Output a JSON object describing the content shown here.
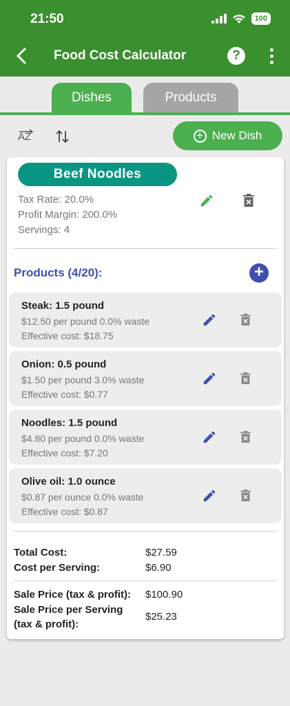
{
  "status": {
    "time": "21:50",
    "battery": "100"
  },
  "app": {
    "title": "Food Cost Calculator"
  },
  "tabs": [
    {
      "label": "Dishes"
    },
    {
      "label": "Products"
    }
  ],
  "toolbar": {
    "new_dish_label": "New Dish"
  },
  "dish": {
    "name": "Beef Noodles",
    "tax_rate": "Tax Rate: 20.0%",
    "profit_margin": "Profit Margin: 200.0%",
    "servings": "Servings: 4",
    "products_title": "Products (4/20):",
    "products": [
      {
        "name": "Steak: 1.5 pound",
        "price_waste": "$12.50 per pound  0.0% waste",
        "effective": "Effective cost: $18.75"
      },
      {
        "name": "Onion: 0.5 pound",
        "price_waste": "$1.50 per pound  3.0% waste",
        "effective": "Effective cost: $0.77"
      },
      {
        "name": "Noodles: 1.5 pound",
        "price_waste": "$4.80 per pound  0.0% waste",
        "effective": "Effective cost: $7.20"
      },
      {
        "name": "Olive oil: 1.0 ounce",
        "price_waste": "$0.87 per ounce  0.0% waste",
        "effective": "Effective cost: $0.87"
      }
    ],
    "summary": {
      "total_cost_label": "Total Cost:",
      "total_cost": "$27.59",
      "cost_per_serving_label": "Cost per Serving:",
      "cost_per_serving": "$6.90",
      "sale_price_label": "Sale Price (tax & profit):",
      "sale_price": "$100.90",
      "sale_price_serving_label": "Sale Price per Serving (tax & profit):",
      "sale_price_serving": "$25.23"
    }
  },
  "colors": {
    "primary": "#3a8f2f",
    "accent_green": "#4caf50",
    "teal": "#0a9582",
    "indigo": "#3f4fb0"
  },
  "icons": {
    "back": "back-arrow-icon",
    "help": "help-icon",
    "menu": "more-vert-icon",
    "sort_az": "sort-alpha-icon",
    "sort": "sort-arrows-icon",
    "add": "add-circle-icon",
    "edit": "pencil-icon",
    "delete": "trash-icon"
  }
}
